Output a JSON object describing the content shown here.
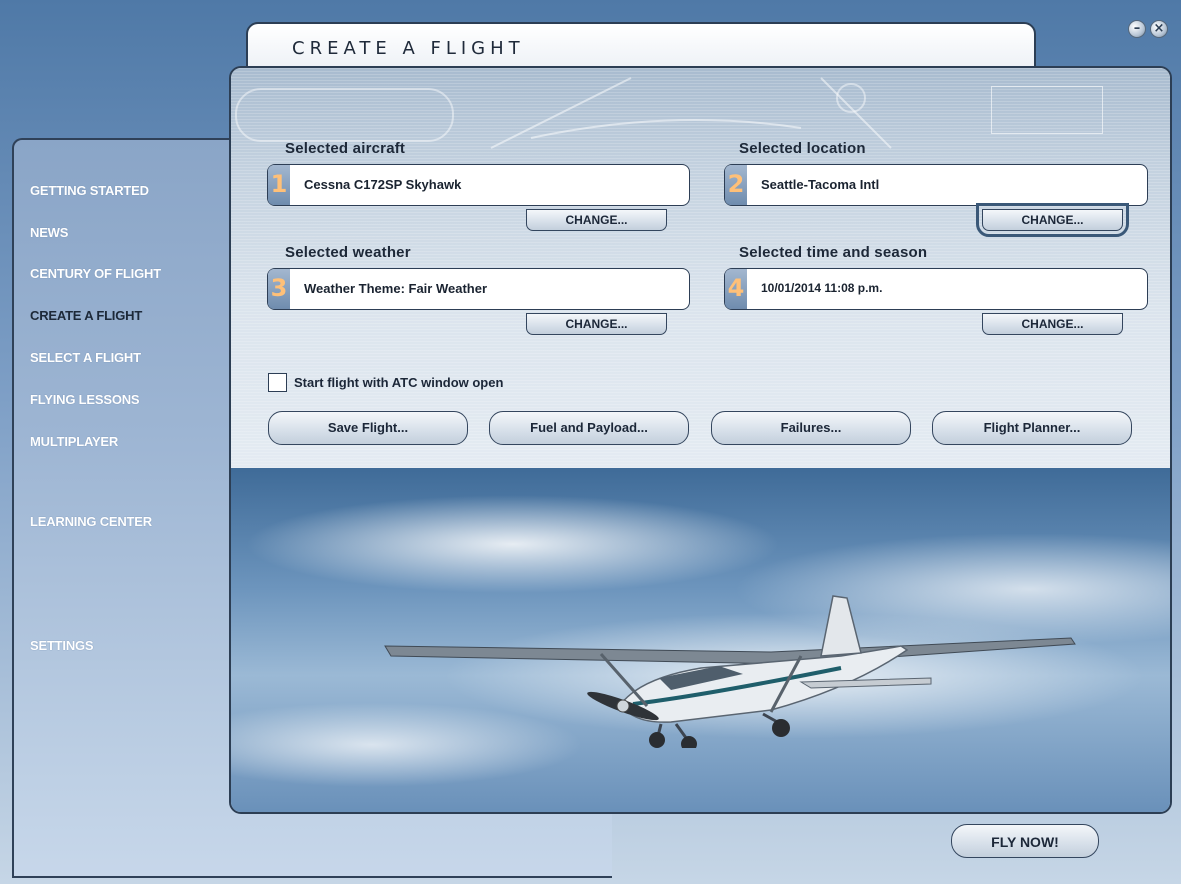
{
  "window": {
    "title": "CREATE A FLIGHT",
    "minimize_glyph": "–",
    "close_glyph": "×"
  },
  "sidebar": {
    "items": [
      {
        "label": "GETTING STARTED"
      },
      {
        "label": "NEWS"
      },
      {
        "label": "CENTURY OF FLIGHT"
      },
      {
        "label": "CREATE A FLIGHT",
        "active": true
      },
      {
        "label": "SELECT A FLIGHT"
      },
      {
        "label": "FLYING LESSONS"
      },
      {
        "label": "MULTIPLAYER"
      },
      {
        "label": "LEARNING CENTER"
      },
      {
        "label": "SETTINGS"
      }
    ]
  },
  "selections": {
    "aircraft": {
      "heading": "Selected aircraft",
      "number": "1",
      "value": "Cessna C172SP Skyhawk",
      "button": "CHANGE..."
    },
    "location": {
      "heading": "Selected location",
      "number": "2",
      "value": "Seattle-Tacoma Intl",
      "button": "CHANGE..."
    },
    "weather": {
      "heading": "Selected weather",
      "number": "3",
      "value": "Weather Theme: Fair Weather",
      "button": "CHANGE..."
    },
    "time": {
      "heading": "Selected time and season",
      "number": "4",
      "value": "10/01/2014 11:08 p.m.",
      "button": "CHANGE..."
    }
  },
  "atc_checkbox": {
    "label": "Start flight with ATC window open",
    "checked": false
  },
  "actions": {
    "save": "Save Flight...",
    "fuel": "Fuel and Payload...",
    "failures": "Failures...",
    "planner": "Flight Planner..."
  },
  "fly_now": "FLY NOW!",
  "colors": {
    "accent": "#2c3e54",
    "number_digit": "#ffc078",
    "sidebar_text": "#ffffff"
  }
}
